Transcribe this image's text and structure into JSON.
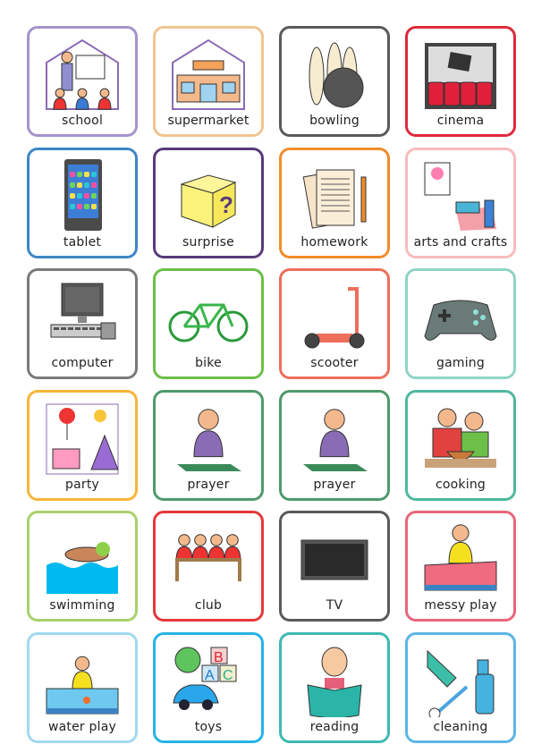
{
  "cards": [
    {
      "label": "school",
      "icon": "school",
      "color": "#a593cc"
    },
    {
      "label": "supermarket",
      "icon": "supermarket",
      "color": "#f1c490"
    },
    {
      "label": "bowling",
      "icon": "bowling",
      "color": "#5a5a5a"
    },
    {
      "label": "cinema",
      "icon": "cinema",
      "color": "#de2a3a"
    },
    {
      "label": "tablet",
      "icon": "tablet",
      "color": "#3d86c6"
    },
    {
      "label": "surprise",
      "icon": "surprise-box",
      "color": "#5a3a7a"
    },
    {
      "label": "homework",
      "icon": "homework",
      "color": "#f28c28"
    },
    {
      "label": "arts and crafts",
      "icon": "arts-and-crafts",
      "color": "#f6bcbc"
    },
    {
      "label": "computer",
      "icon": "computer",
      "color": "#7a7a7a"
    },
    {
      "label": "bike",
      "icon": "bike",
      "color": "#6cbf48"
    },
    {
      "label": "scooter",
      "icon": "scooter",
      "color": "#ee6e5c"
    },
    {
      "label": "gaming",
      "icon": "game-controller",
      "color": "#8fd4c6"
    },
    {
      "label": "party",
      "icon": "party",
      "color": "#f7b53a"
    },
    {
      "label": "prayer",
      "icon": "prayer",
      "color": "#4f9a6c"
    },
    {
      "label": "prayer",
      "icon": "prayer",
      "color": "#4f9a6c"
    },
    {
      "label": "cooking",
      "icon": "cooking",
      "color": "#4fb89e"
    },
    {
      "label": "swimming",
      "icon": "swimming",
      "color": "#a8d16c"
    },
    {
      "label": "club",
      "icon": "club",
      "color": "#e5383b"
    },
    {
      "label": "TV",
      "icon": "tv",
      "color": "#5a5a5a"
    },
    {
      "label": "messy play",
      "icon": "messy-play",
      "color": "#e9667a"
    },
    {
      "label": "water play",
      "icon": "water-play",
      "color": "#a3d8f0"
    },
    {
      "label": "toys",
      "icon": "toys",
      "color": "#26b4e2"
    },
    {
      "label": "reading",
      "icon": "reading",
      "color": "#3dbab2"
    },
    {
      "label": "cleaning",
      "icon": "cleaning",
      "color": "#5bb5e6"
    }
  ]
}
